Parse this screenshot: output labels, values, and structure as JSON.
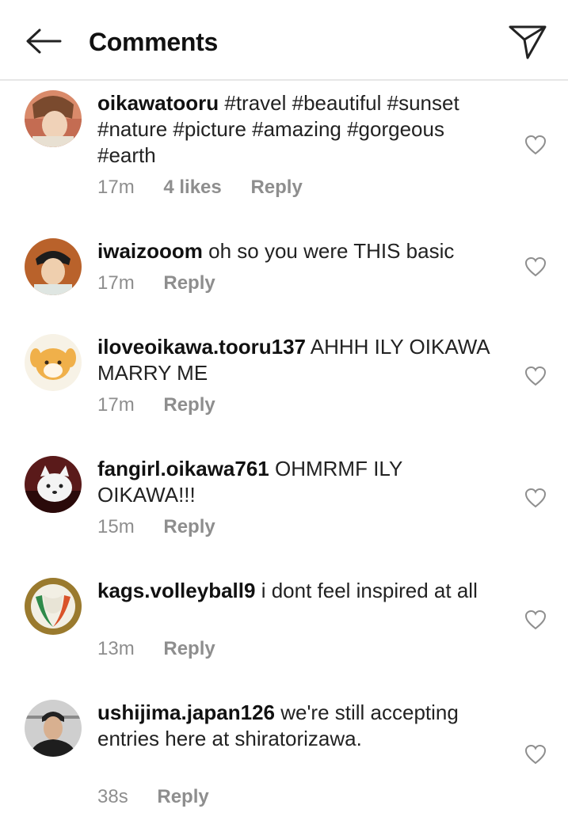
{
  "header": {
    "title": "Comments"
  },
  "comments": [
    {
      "username": "oikawatooru",
      "text": "#travel #beautiful #sunset #nature #picture #amazing #gorgeous #earth",
      "time": "17m",
      "likes": "4 likes",
      "reply": "Reply"
    },
    {
      "username": "iwaizooom",
      "text": "oh so you were THIS basic",
      "time": "17m",
      "likes": "",
      "reply": "Reply"
    },
    {
      "username": "iloveoikawa.tooru137",
      "text": "AHHH ILY OIKAWA MARRY ME",
      "time": "17m",
      "likes": "",
      "reply": "Reply"
    },
    {
      "username": "fangirl.oikawa761",
      "text": "OHMRMF ILY OIKAWA!!!",
      "time": "15m",
      "likes": "",
      "reply": "Reply"
    },
    {
      "username": "kags.volleyball9",
      "text": "i dont feel inspired at all",
      "time": "13m",
      "likes": "",
      "reply": "Reply"
    },
    {
      "username": "ushijima.japan126",
      "text": "we're still accepting entries here at shiratorizawa.",
      "time": "38s",
      "likes": "",
      "reply": "Reply"
    }
  ]
}
